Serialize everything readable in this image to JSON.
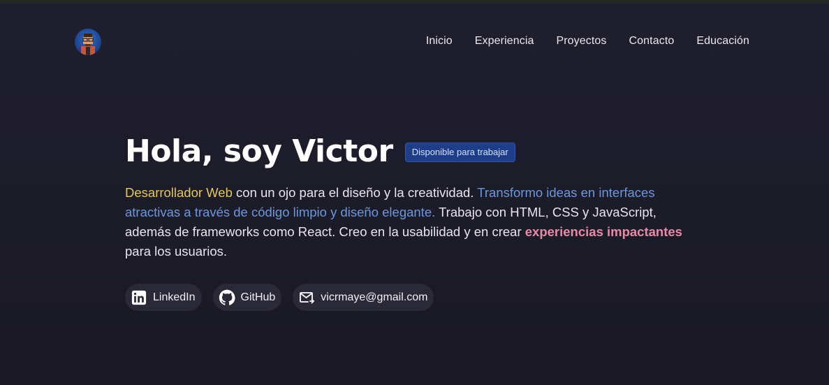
{
  "nav": {
    "items": [
      {
        "label": "Inicio"
      },
      {
        "label": "Experiencia"
      },
      {
        "label": "Proyectos"
      },
      {
        "label": "Contacto"
      },
      {
        "label": "Educación"
      }
    ]
  },
  "hero": {
    "title": "Hola, soy Victor",
    "badge": "Disponible para trabajar",
    "description": {
      "part1": "Desarrollador Web",
      "part2": " con un ojo para el diseño y la creatividad. ",
      "part3": "Transformo ideas en interfaces atractivas a través de código limpio y diseño elegante.",
      "part4": " Trabajo con HTML, CSS y JavaScript, además de frameworks como React. Creo en la usabilidad y en crear ",
      "part5": "experiencias impactantes",
      "part6": " para los usuarios."
    }
  },
  "links": {
    "linkedin": "LinkedIn",
    "github": "GitHub",
    "email": "vicrmaye@gmail.com"
  },
  "icons": {
    "avatar": "avatar",
    "linkedin": "linkedin-icon",
    "github": "github-icon",
    "email": "mail-icon"
  },
  "colors": {
    "background": "#1d1c2a",
    "accent_yellow": "#e4c65a",
    "accent_blue": "#6b97de",
    "accent_pink": "#e88aa6",
    "badge_bg": "#1f3e8a"
  }
}
